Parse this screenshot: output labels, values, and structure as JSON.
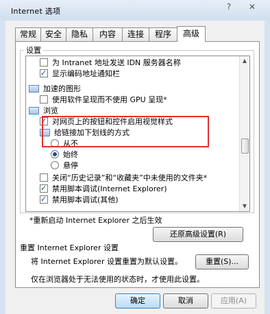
{
  "window": {
    "title": "Internet 选项",
    "help_glyph": "?",
    "close_glyph": "✕"
  },
  "tabs": [
    "常规",
    "安全",
    "隐私",
    "内容",
    "连接",
    "程序",
    "高级"
  ],
  "settings_group_label": "设置",
  "items": [
    {
      "kind": "check",
      "checked": false,
      "indent": 1,
      "label": "为 Intranet 地址发送 IDN 服务器名称"
    },
    {
      "kind": "check",
      "checked": true,
      "indent": 1,
      "label": "显示编码地址通知栏"
    },
    {
      "kind": "folder",
      "indent": 0,
      "label": "加速的图形"
    },
    {
      "kind": "check",
      "checked": false,
      "indent": 1,
      "label": "使用软件呈现而不使用 GPU 呈现*"
    },
    {
      "kind": "folder",
      "indent": 0,
      "label": "浏览"
    },
    {
      "kind": "check",
      "checked": true,
      "indent": 1,
      "label": "对网页上的按钮和控件启用视觉样式"
    },
    {
      "kind": "folder",
      "indent": 1,
      "label": "给链接加下划线的方式"
    },
    {
      "kind": "radio",
      "checked": false,
      "indent": 2,
      "label": "从不"
    },
    {
      "kind": "radio",
      "checked": true,
      "indent": 2,
      "label": "始终"
    },
    {
      "kind": "radio",
      "checked": false,
      "indent": 2,
      "label": "悬停"
    },
    {
      "kind": "check",
      "checked": false,
      "indent": 1,
      "label": "关闭“历史记录”和“收藏夹”中未使用的文件夹*"
    },
    {
      "kind": "check",
      "checked": true,
      "indent": 1,
      "label": "禁用脚本调试(Internet Explorer)"
    },
    {
      "kind": "check",
      "checked": true,
      "indent": 1,
      "label": "禁用脚本调试(其他)"
    }
  ],
  "restart_note": "*重新启动 Internet Explorer 之后生效",
  "restore_button": "还原高级设置(R)",
  "reset_heading": "重置 Internet Explorer 设置",
  "reset_desc": "将 Internet Explorer 设置重置为默认设置。",
  "reset_button": "重置(S)...",
  "reset_note": "仅在浏览器处于无法使用的状态时，才使用此设置。",
  "buttons": {
    "ok": "确定",
    "cancel": "取消",
    "apply": "应用(A)"
  }
}
